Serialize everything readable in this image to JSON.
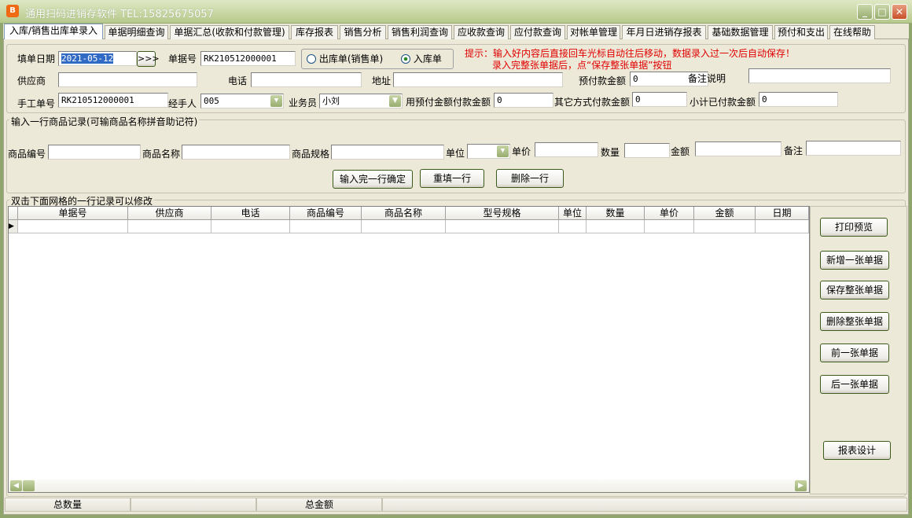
{
  "window": {
    "title": "通用扫码进销存软件 TEL:15825675057",
    "icon_label": "B"
  },
  "tabs": [
    "入库/销售出库单录入",
    "单据明细查询",
    "单据汇总(收款和付款管理)",
    "库存报表",
    "销售分析",
    "销售利润查询",
    "应收款查询",
    "应付款查询",
    "对帐单管理",
    "年月日进销存报表",
    "基础数据管理",
    "预付和支出",
    "在线帮助"
  ],
  "header": {
    "date_label": "填单日期",
    "date_value": "2021-05-12",
    "date_button": ">>>",
    "doc_no_label": "单据号",
    "doc_no_value": "RK210512000001",
    "radio_out": "出库单(销售单)",
    "radio_in": "入库单",
    "hint_line1": "提示：输入好内容后直接回车光标自动往后移动，数据录入过一次后自动保存！",
    "hint_line2": "录入完整张单据后，点“保存整张单据”按钮",
    "supplier_label": "供应商",
    "supplier_value": "",
    "phone_label": "电话",
    "phone_value": "",
    "address_label": "地址",
    "address_value": "",
    "prepay_label": "预付款金额",
    "prepay_value": "0",
    "remark_label": "备注说明",
    "remark_value": "",
    "manual_no_label": "手工单号",
    "manual_no_value": "RK210512000001",
    "handler_label": "经手人",
    "handler_value": "005",
    "salesman_label": "业务员",
    "salesman_value": "小刘",
    "prepay_pay_label": "用预付金额付款金额",
    "prepay_pay_value": "0",
    "other_pay_label": "其它方式付款金额",
    "other_pay_value": "0",
    "subtotal_label": "小计已付款金额",
    "subtotal_value": "0"
  },
  "item_entry": {
    "group_title": "输入一行商品记录(可输商品名称拼音助记符)",
    "code_label": "商品编号",
    "name_label": "商品名称",
    "spec_label": "商品规格",
    "unit_label": "单位",
    "price_label": "单价",
    "qty_label": "数量",
    "amount_label": "金额",
    "note_label": "备注",
    "confirm_button": "输入完一行确定",
    "refill_button": "重填一行",
    "delete_button": "删除一行"
  },
  "grid": {
    "group_title": "双击下面网格的一行记录可以修改",
    "columns": [
      "单据号",
      "供应商",
      "电话",
      "商品编号",
      "商品名称",
      "型号规格",
      "单位",
      "数量",
      "单价",
      "金额",
      "日期"
    ]
  },
  "actions": [
    "打印预览",
    "新增一张单据",
    "保存整张单据",
    "删除整张单据",
    "前一张单据",
    "后一张单据",
    "报表设计"
  ],
  "status": {
    "total_qty_label": "总数量",
    "total_qty_value": "",
    "total_amount_label": "总金额",
    "total_amount_value": ""
  },
  "colors": {
    "hint": "#e00000",
    "frame": "#8fa56c",
    "selection": "#316ac5"
  }
}
